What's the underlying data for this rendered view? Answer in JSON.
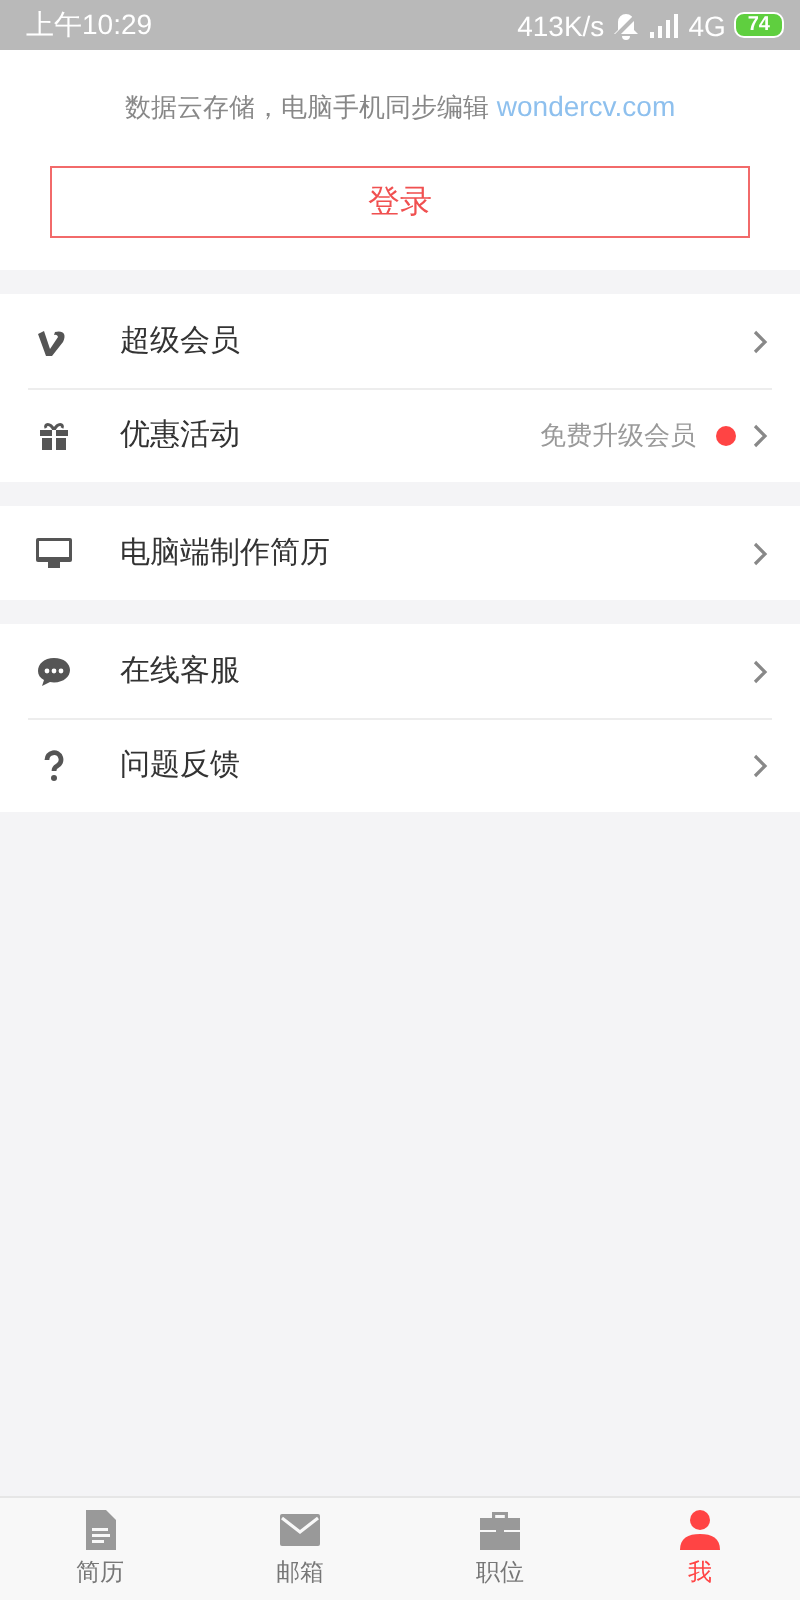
{
  "status_bar": {
    "time": "上午10:29",
    "speed": "413K/s",
    "network": "4G",
    "battery": "74"
  },
  "header": {
    "tagline": "数据云存储，电脑手机同步编辑",
    "link": "wondercv.com",
    "login_button": "登录"
  },
  "menu_groups": [
    {
      "items": [
        {
          "kind": "vip",
          "label": "超级会员"
        },
        {
          "kind": "gift",
          "label": "优惠活动",
          "note": "免费升级会员",
          "badge": true
        }
      ]
    },
    {
      "items": [
        {
          "kind": "monitor",
          "label": "电脑端制作简历"
        }
      ]
    },
    {
      "items": [
        {
          "kind": "chat",
          "label": "在线客服"
        },
        {
          "kind": "question",
          "label": "问题反馈"
        }
      ]
    }
  ],
  "tab_bar": [
    {
      "kind": "document",
      "label": "简历",
      "selected": false
    },
    {
      "kind": "mail",
      "label": "邮箱",
      "selected": false
    },
    {
      "kind": "briefcase",
      "label": "职位",
      "selected": false
    },
    {
      "kind": "person",
      "label": "我",
      "selected": true
    }
  ]
}
